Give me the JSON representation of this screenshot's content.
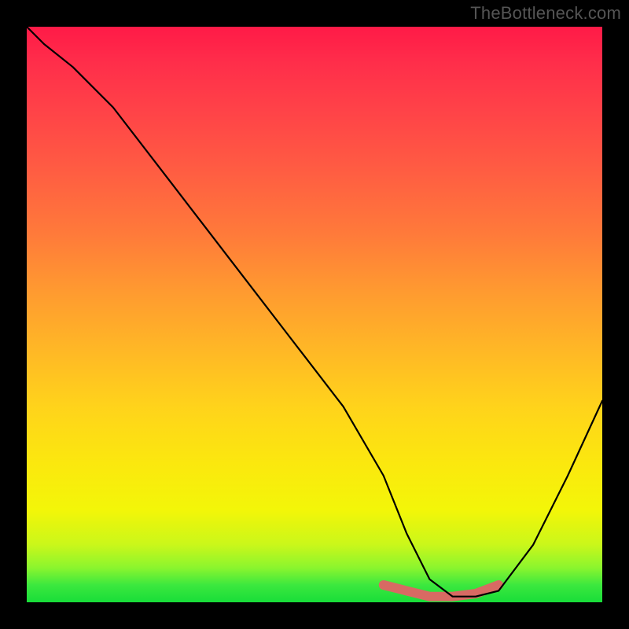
{
  "watermark": "TheBottleneck.com",
  "colors": {
    "background": "#000000",
    "curve": "#000000",
    "highlight": "#d86a63",
    "gradient_stops": [
      "#ff1a47",
      "#ff7a3a",
      "#ffd31b",
      "#f3f608",
      "#18dd39"
    ]
  },
  "chart_data": {
    "type": "line",
    "title": "",
    "xlabel": "",
    "ylabel": "",
    "xlim": [
      0,
      100
    ],
    "ylim": [
      0,
      100
    ],
    "grid": false,
    "legend": false,
    "series": [
      {
        "name": "bottleneck-curve",
        "x": [
          0,
          3,
          8,
          15,
          25,
          35,
          45,
          55,
          62,
          66,
          70,
          74,
          78,
          82,
          88,
          94,
          100
        ],
        "y": [
          100,
          97,
          93,
          86,
          73,
          60,
          47,
          34,
          22,
          12,
          4,
          1,
          1,
          2,
          10,
          22,
          35
        ]
      }
    ],
    "annotations": [
      {
        "name": "floor-segment",
        "x": [
          62,
          66,
          70,
          74,
          78,
          82
        ],
        "y": [
          3,
          2,
          1,
          1,
          1.5,
          3
        ]
      }
    ]
  }
}
